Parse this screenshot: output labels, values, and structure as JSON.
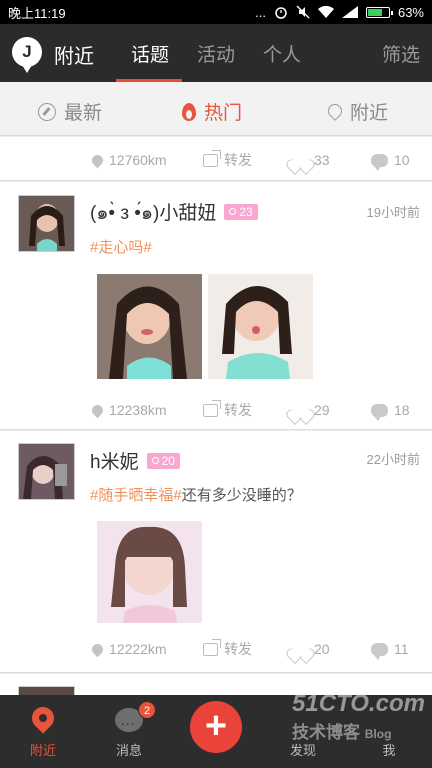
{
  "status_bar": {
    "time": "晚上11:19",
    "signal_dots": "...",
    "battery": "63%",
    "battery_level": 0.63
  },
  "header": {
    "logo": "J",
    "location": "附近",
    "tabs": [
      {
        "label": "话题",
        "active": true
      },
      {
        "label": "活动",
        "active": false
      },
      {
        "label": "个人",
        "active": false
      }
    ],
    "filter": "筛选"
  },
  "subtabs": [
    {
      "label": "最新",
      "icon": "compass-icon",
      "active": false
    },
    {
      "label": "热门",
      "icon": "fire-icon",
      "active": true
    },
    {
      "label": "附近",
      "icon": "location-pin-icon",
      "active": false
    }
  ],
  "partial_post": {
    "distance": "12760km",
    "share": "转发",
    "likes": "33",
    "comments": "10"
  },
  "posts": [
    {
      "username": "(๑•̀ з •́๑)小甜妞",
      "level": "23",
      "time": "19小时前",
      "topic": "#走心吗#",
      "text": "",
      "photos": 2,
      "distance": "12238km",
      "share": "转发",
      "likes": "29",
      "comments": "18"
    },
    {
      "username": "h米妮",
      "level": "20",
      "time": "22小时前",
      "topic": "#随手晒幸福#",
      "text": "还有多少没睡的？",
      "photos": 1,
      "distance": "12222km",
      "share": "转发",
      "likes": "20",
      "comments": "11"
    }
  ],
  "tabbar": {
    "nearby": "附近",
    "messages": "消息",
    "messages_badge": "2",
    "discover": "发现",
    "me": "我"
  },
  "watermark": {
    "site": "51CTO.com",
    "subtitle": "技术博客",
    "tag": "Blog"
  },
  "colors": {
    "accent": "#e94c3d",
    "topic": "#f0915a",
    "level_badge": "#f8a8d0",
    "header_bg": "#2b2b2b"
  }
}
